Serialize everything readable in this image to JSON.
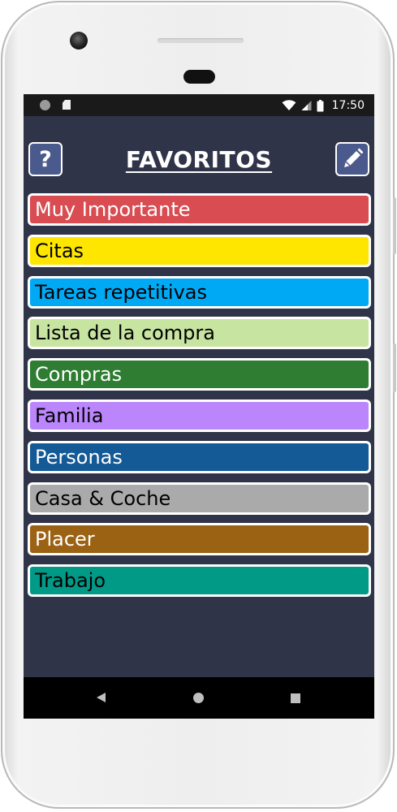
{
  "status_bar": {
    "time": "17:50"
  },
  "header": {
    "title": "FAVORITOS",
    "help_label": "?",
    "help_icon": "question-mark-icon",
    "edit_icon": "pencil-icon"
  },
  "categories": [
    {
      "label": "Muy Importante",
      "color": "#d84c52",
      "text_color": "#ffffff"
    },
    {
      "label": "Citas",
      "color": "#ffe600",
      "text_color": "#000000"
    },
    {
      "label": "Tareas repetitivas",
      "color": "#00a9f4",
      "text_color": "#000000"
    },
    {
      "label": "Lista de la compra",
      "color": "#c7e4a1",
      "text_color": "#000000"
    },
    {
      "label": "Compras",
      "color": "#2e7d32",
      "text_color": "#ffffff"
    },
    {
      "label": "Familia",
      "color": "#bb86fc",
      "text_color": "#000000"
    },
    {
      "label": "Personas",
      "color": "#145a96",
      "text_color": "#ffffff"
    },
    {
      "label": "Casa & Coche",
      "color": "#aaaaaa",
      "text_color": "#000000"
    },
    {
      "label": "Placer",
      "color": "#9c6214",
      "text_color": "#ffffff"
    },
    {
      "label": "Trabajo",
      "color": "#009a87",
      "text_color": "#000000"
    }
  ],
  "nav_bar": {
    "back_icon": "back-triangle-icon",
    "home_icon": "home-circle-icon",
    "recent_icon": "recent-apps-square-icon"
  },
  "colors": {
    "app_background": "#303449",
    "header_button": "#4a5a8c"
  }
}
